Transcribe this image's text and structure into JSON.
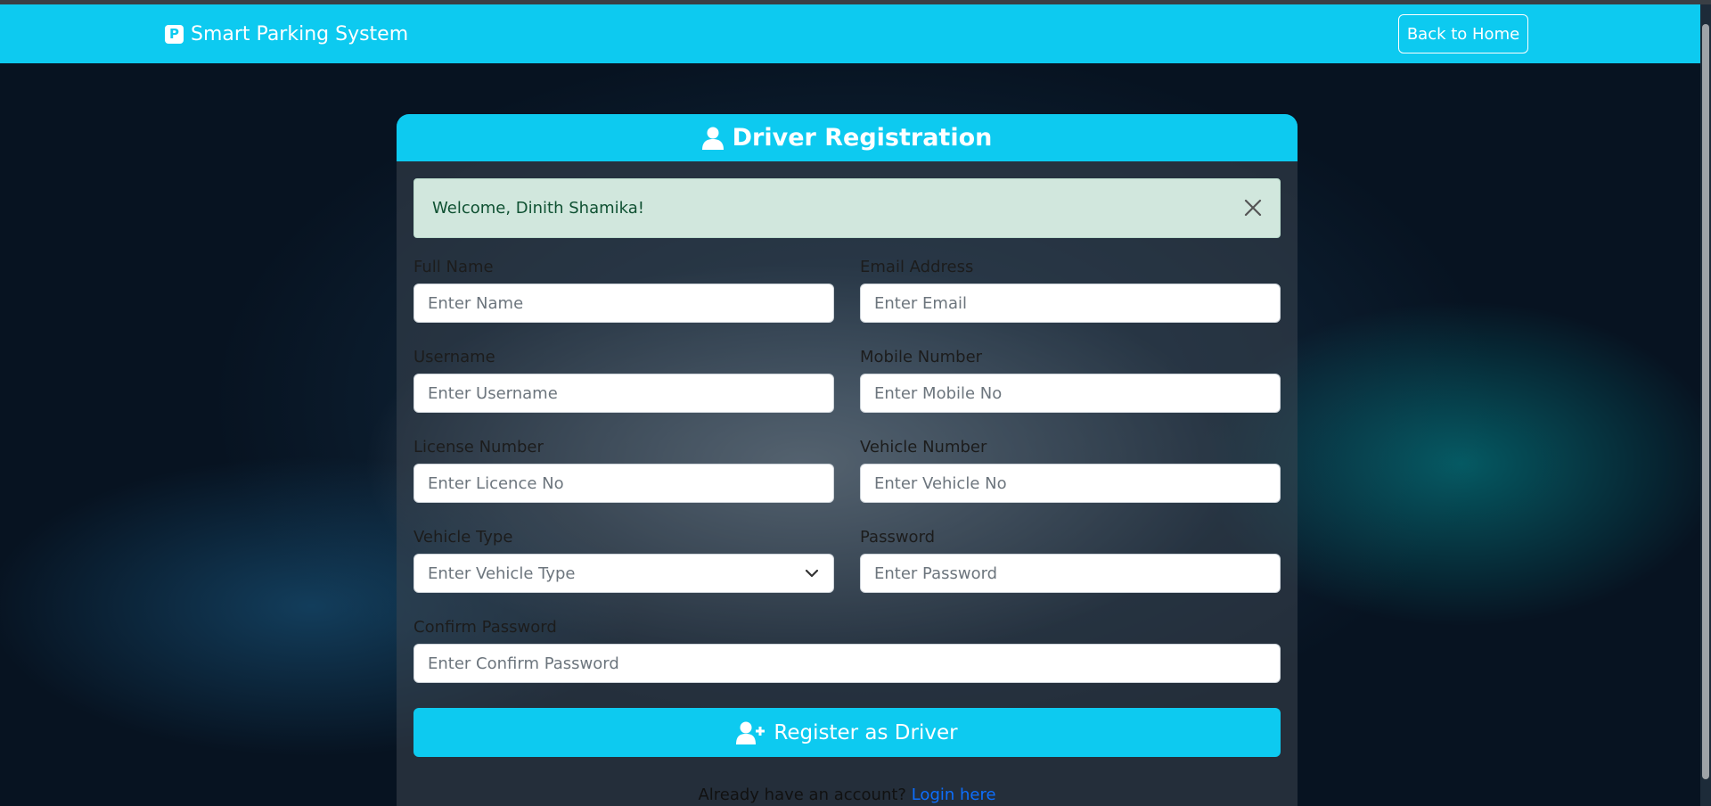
{
  "navbar": {
    "brand_icon_letter": "P",
    "brand": "Smart Parking System",
    "back_button": "Back to Home"
  },
  "card": {
    "title": "Driver Registration",
    "alert": {
      "message": "Welcome, Dinith Shamika!"
    },
    "fields": {
      "full_name": {
        "label": "Full Name",
        "placeholder": "Enter Name"
      },
      "email": {
        "label": "Email Address",
        "placeholder": "Enter Email"
      },
      "username": {
        "label": "Username",
        "placeholder": "Enter Username"
      },
      "mobile": {
        "label": "Mobile Number",
        "placeholder": "Enter Mobile No"
      },
      "license": {
        "label": "License Number",
        "placeholder": "Enter Licence No"
      },
      "vehicle_number": {
        "label": "Vehicle Number",
        "placeholder": "Enter Vehicle No"
      },
      "vehicle_type": {
        "label": "Vehicle Type",
        "selected": "Enter Vehicle Type"
      },
      "password": {
        "label": "Password",
        "placeholder": "Enter Password"
      },
      "confirm_password": {
        "label": "Confirm Password",
        "placeholder": "Enter Confirm Password"
      }
    },
    "submit_button": "Register as Driver",
    "login_prompt": "Already have an account?",
    "login_link": "Login here"
  },
  "colors": {
    "accent": "#0dcaf0",
    "alert_bg": "#d1e7dd",
    "link": "#0d6efd"
  },
  "icons": [
    "parking-icon",
    "user-icon",
    "close-icon",
    "chevron-down-icon",
    "user-plus-icon"
  ]
}
